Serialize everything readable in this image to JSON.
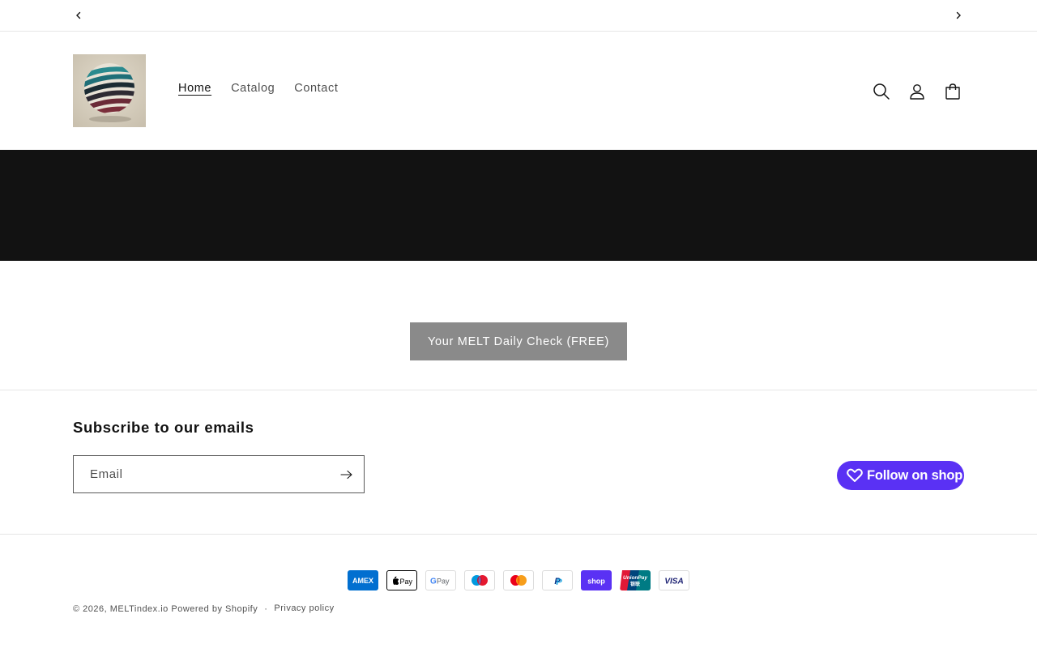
{
  "announcement": {
    "prev_icon": "chevron-left-icon",
    "next_icon": "chevron-right-icon"
  },
  "header": {
    "logo_icon": "striped-sphere-logo",
    "nav": [
      {
        "label": "Home",
        "active": true
      },
      {
        "label": "Catalog",
        "active": false
      },
      {
        "label": "Contact",
        "active": false
      }
    ],
    "icons": [
      "search-icon",
      "account-icon",
      "cart-icon"
    ]
  },
  "colors": {
    "banner": "#121212",
    "cta_bg": "#8a8a8a",
    "shop_purple": "#5a31f4",
    "text": "#121212"
  },
  "main": {
    "cta_label": "Your MELT Daily Check (FREE)"
  },
  "newsletter": {
    "title": "Subscribe to our emails",
    "email_placeholder": "Email",
    "email_value": "",
    "submit_icon": "arrow-right-icon"
  },
  "follow_shop": {
    "label": "Follow on shop",
    "icon": "heart-icon"
  },
  "payments": [
    "American Express",
    "Apple Pay",
    "Google Pay",
    "Maestro",
    "Mastercard",
    "PayPal",
    "Shop Pay",
    "Union Pay",
    "Visa"
  ],
  "footer": {
    "copyright_prefix": "© 2026,",
    "store_name": "MELTindex.io",
    "powered": "Powered by Shopify",
    "separator": "·",
    "privacy": "Privacy policy"
  }
}
